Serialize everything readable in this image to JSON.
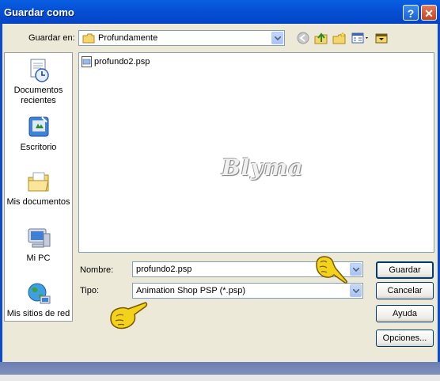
{
  "window": {
    "title": "Guardar como",
    "help_label": "?",
    "close_label": "✕"
  },
  "toolbar": {
    "location_label": "Guardar en:",
    "location_value": "Profundamente",
    "icons": [
      "back-icon",
      "up-folder-icon",
      "new-folder-icon",
      "views-menu-icon",
      "tools-icon"
    ]
  },
  "places": [
    {
      "label": "Documentos recientes",
      "icon": "recent-documents-icon"
    },
    {
      "label": "Escritorio",
      "icon": "desktop-icon"
    },
    {
      "label": "Mis documentos",
      "icon": "my-documents-icon"
    },
    {
      "label": "Mi PC",
      "icon": "my-computer-icon"
    },
    {
      "label": "Mis sitios de red",
      "icon": "network-places-icon"
    }
  ],
  "files": [
    {
      "name": "profundo2.psp",
      "icon": "psp-file-icon"
    }
  ],
  "watermark": "Blyma",
  "form": {
    "name_label": "Nombre:",
    "name_value": "profundo2.psp",
    "type_label": "Tipo:",
    "type_value": "Animation Shop PSP (*.psp)"
  },
  "buttons": {
    "save": "Guardar",
    "cancel": "Cancelar",
    "help": "Ayuda",
    "options": "Opciones..."
  },
  "colors": {
    "titlebar": "#0551d8",
    "dialog_bg": "#ece9d8",
    "field_border": "#7f9db9",
    "button_border": "#003c74",
    "hand_pointer": "#f2d21b"
  }
}
